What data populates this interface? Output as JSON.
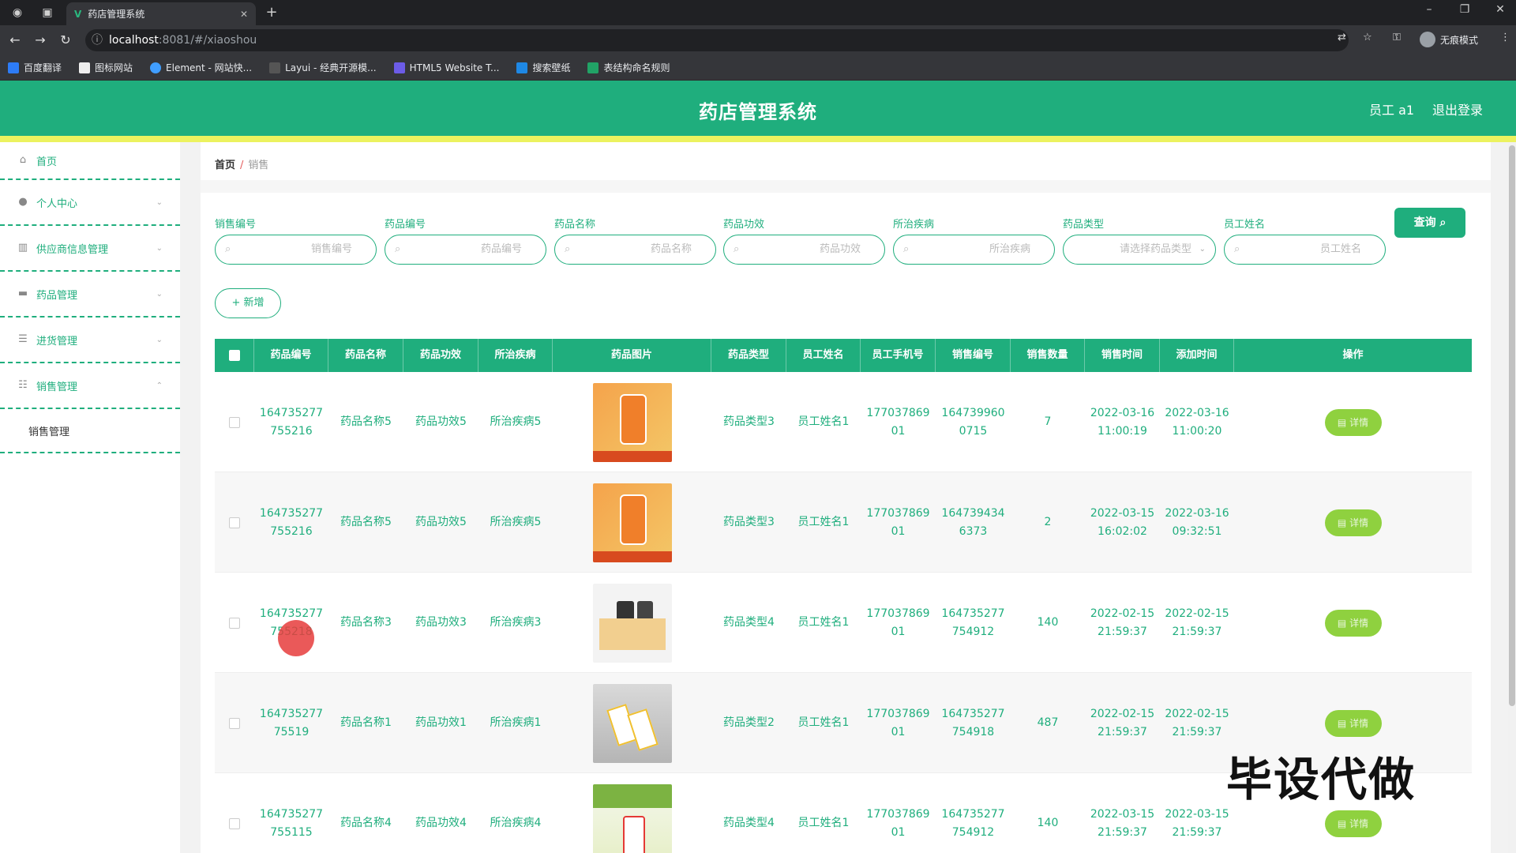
{
  "browser": {
    "tab_title": "药店管理系统",
    "url_host": "localhost",
    "url_path": ":8081/#/xiaoshou",
    "profile_label": "无痕模式",
    "bookmarks": [
      "百度翻译",
      "图标网站",
      "Element - 网站快...",
      "Layui - 经典开源模...",
      "HTML5 Website T...",
      "搜索壁纸",
      "表结构命名规则"
    ]
  },
  "header": {
    "title": "药店管理系统",
    "user": "员工 a1",
    "logout": "退出登录"
  },
  "sidebar": {
    "items": [
      {
        "label": "首页",
        "icon": "home-icon"
      },
      {
        "label": "个人中心",
        "icon": "user-icon"
      },
      {
        "label": "供应商信息管理",
        "icon": "chart-icon"
      },
      {
        "label": "药品管理",
        "icon": "monitor-icon"
      },
      {
        "label": "进货管理",
        "icon": "list-icon"
      },
      {
        "label": "销售管理",
        "icon": "sliders-icon"
      }
    ],
    "sub_item": "销售管理"
  },
  "breadcrumb": {
    "home": "首页",
    "sep": "/",
    "current": "销售"
  },
  "filters": [
    {
      "label": "销售编号",
      "placeholder": "销售编号"
    },
    {
      "label": "药品编号",
      "placeholder": "药品编号"
    },
    {
      "label": "药品名称",
      "placeholder": "药品名称"
    },
    {
      "label": "药品功效",
      "placeholder": "药品功效"
    },
    {
      "label": "所治疾病",
      "placeholder": "所治疾病"
    },
    {
      "label": "药品类型",
      "placeholder": "请选择药品类型"
    },
    {
      "label": "员工姓名",
      "placeholder": "员工姓名"
    }
  ],
  "buttons": {
    "query": "查询",
    "add": "+ 新增",
    "detail": "详情"
  },
  "table": {
    "columns": [
      "药品编号",
      "药品名称",
      "药品功效",
      "所治疾病",
      "药品图片",
      "药品类型",
      "员工姓名",
      "员工手机号",
      "销售编号",
      "销售数量",
      "销售时间",
      "添加时间",
      "操作"
    ],
    "rows": [
      {
        "code": "164735277755216",
        "name": "药品名称5",
        "effect": "药品功效5",
        "disease": "所治疾病5",
        "img": "orange-bottle",
        "type": "药品类型3",
        "staff": "员工姓名1",
        "phone": "17703786901",
        "sale_no": "1647399600715",
        "qty": "7",
        "sale_time": "2022-03-16 11:00:19",
        "add_time": "2022-03-16 11:00:20"
      },
      {
        "code": "164735277755216",
        "name": "药品名称5",
        "effect": "药品功效5",
        "disease": "所治疾病5",
        "img": "orange-bottle",
        "type": "药品类型3",
        "staff": "员工姓名1",
        "phone": "17703786901",
        "sale_no": "1647394346373",
        "qty": "2",
        "sale_time": "2022-03-15 16:02:02",
        "add_time": "2022-03-16 09:32:51"
      },
      {
        "code": "164735277755218",
        "name": "药品名称3",
        "effect": "药品功效3",
        "disease": "所治疾病3",
        "img": "supplement-boxes",
        "type": "药品类型4",
        "staff": "员工姓名1",
        "phone": "17703786901",
        "sale_no": "164735277754912",
        "qty": "140",
        "sale_time": "2022-02-15 21:59:37",
        "add_time": "2022-02-15 21:59:37"
      },
      {
        "code": "16473527775519",
        "name": "药品名称1",
        "effect": "药品功效1",
        "disease": "所治疾病1",
        "img": "cards",
        "type": "药品类型2",
        "staff": "员工姓名1",
        "phone": "17703786901",
        "sale_no": "164735277754918",
        "qty": "487",
        "sale_time": "2022-02-15 21:59:37",
        "add_time": "2022-02-15 21:59:37"
      },
      {
        "code": "164735277755115",
        "name": "药品名称4",
        "effect": "药品功效4",
        "disease": "所治疾病4",
        "img": "vitamin-tube",
        "type": "药品类型4",
        "staff": "员工姓名1",
        "phone": "17703786901",
        "sale_no": "164735277754912",
        "qty": "140",
        "sale_time": "2022-03-15 21:59:37",
        "add_time": "2022-03-15 21:59:37"
      }
    ]
  },
  "watermark": "毕设代做",
  "colors": {
    "primary": "#1fae7d",
    "accent_bar": "#ecf25f",
    "detail_button": "#8fd13f"
  }
}
